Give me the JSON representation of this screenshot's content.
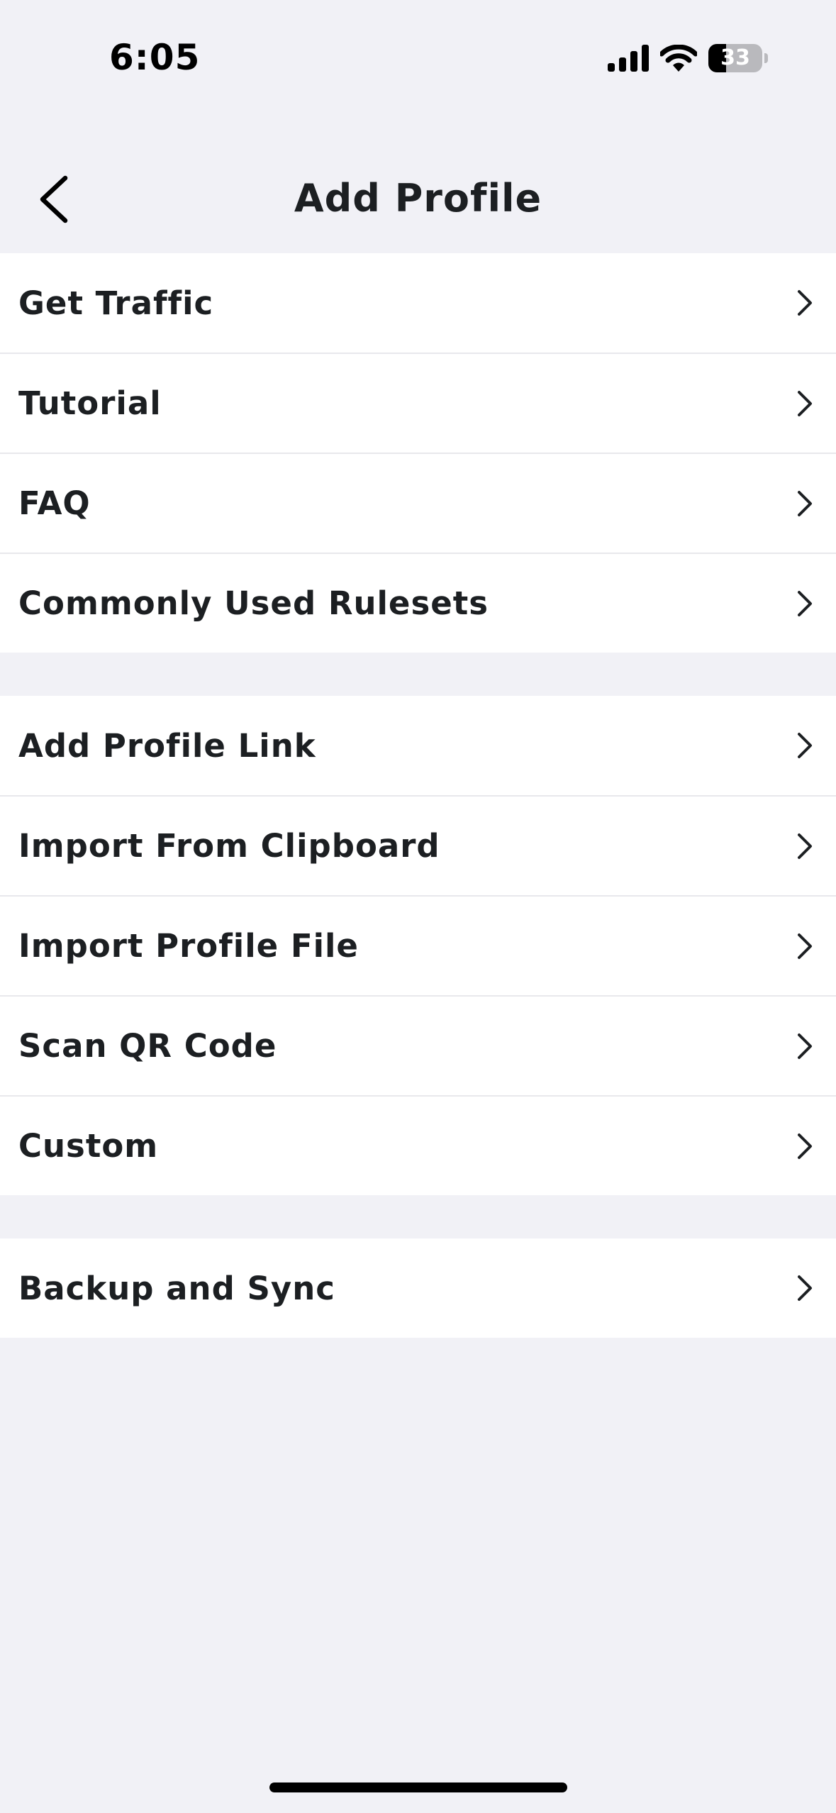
{
  "status_bar": {
    "time": "6:05",
    "battery_level": "33",
    "battery_fraction": 0.33,
    "icons": [
      "signal-icon",
      "wifi-icon",
      "battery-icon"
    ]
  },
  "nav": {
    "title": "Add Profile",
    "back_icon": "chevron-left-icon"
  },
  "groups": [
    {
      "items": [
        {
          "label": "Get Traffic"
        },
        {
          "label": "Tutorial"
        },
        {
          "label": "FAQ"
        },
        {
          "label": "Commonly Used Rulesets"
        }
      ]
    },
    {
      "items": [
        {
          "label": "Add Profile Link"
        },
        {
          "label": "Import From Clipboard"
        },
        {
          "label": "Import Profile File"
        },
        {
          "label": "Scan QR Code"
        },
        {
          "label": "Custom"
        }
      ]
    },
    {
      "items": [
        {
          "label": "Backup and Sync"
        }
      ]
    }
  ],
  "colors": {
    "background": "#f1f1f6",
    "row_background": "#ffffff",
    "text": "#1c1f22",
    "separator": "#e8e8ec"
  }
}
